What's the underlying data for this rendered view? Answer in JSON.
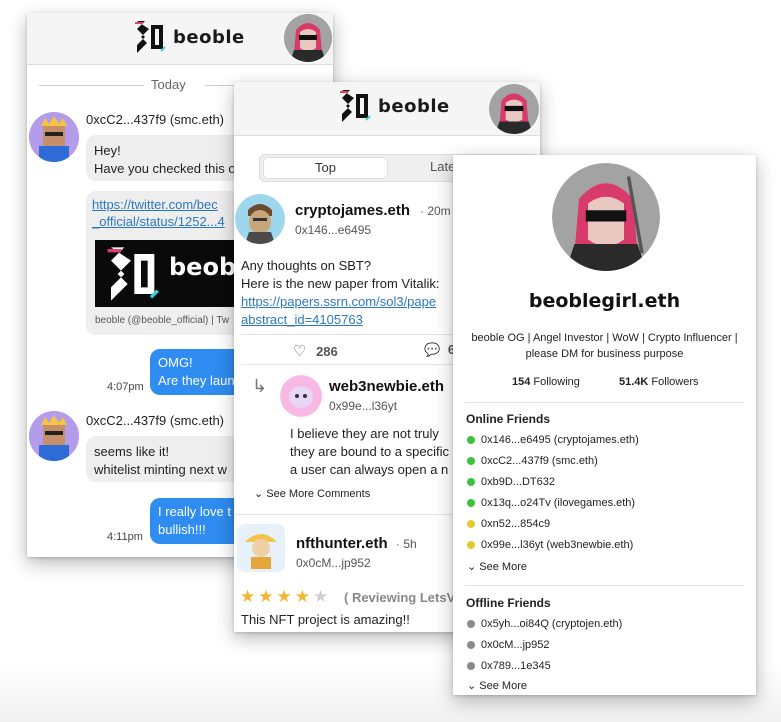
{
  "brand": {
    "name": "beoble"
  },
  "chat": {
    "date_label": "Today",
    "messages": [
      {
        "sender": "0xcC2...437f9 (smc.eth)",
        "text_1": "Hey!",
        "text_2": "Have you checked this o"
      },
      {
        "link_1": "https://twitter.com/bec",
        "link_2": "_official/status/1252...4",
        "preview_caption": "beoble (@beoble_official) | Tw"
      },
      {
        "out_1": "OMG!",
        "out_2": "Are they laun",
        "time": "4:07pm"
      },
      {
        "sender": "0xcC2...437f9 (smc.eth)",
        "text_1": "seems like it!",
        "text_2": "whitelist minting next w"
      },
      {
        "out_1": "I really love t",
        "out_2": "bullish!!!",
        "time": "4:11pm"
      }
    ]
  },
  "feed": {
    "tabs": [
      "Top",
      "Late"
    ],
    "post": {
      "author": "cryptojames.eth",
      "age": "· 20m",
      "address": "0x146...e6495",
      "line_1": "Any thoughts on SBT?",
      "line_2": "Here is the new paper from Vitalik:",
      "link_1": "https://papers.ssrn.com/sol3/pape",
      "link_2": "abstract_id=4105763",
      "likes": "286",
      "comments": "6"
    },
    "reply": {
      "author": "web3newbie.eth",
      "address": "0x99e...l36yt",
      "line_1": "I believe they are not truly",
      "line_2": "they are bound to a specific",
      "line_3": "a user can always open a n"
    },
    "see_more_comments": "See More Comments",
    "review": {
      "author": "nfthunter.eth",
      "age": "· 5h",
      "address": "0x0cM...jp952",
      "stars_filled": 4,
      "stars_total": 5,
      "reviewing": "( Reviewing LetsV",
      "text": "This NFT project is amazing!!"
    }
  },
  "profile": {
    "name": "beoblegirl.eth",
    "bio_1": "beoble OG | Angel Investor | WoW | Crypto Influencer |",
    "bio_2": "please DM for business purpose",
    "following_count": "154",
    "following_label": "Following",
    "followers_count": "51.4K",
    "followers_label": "Followers",
    "online_title": "Online Friends",
    "online": [
      {
        "name": "0x146...e6495 (cryptojames.eth)",
        "color": "#3cc23c"
      },
      {
        "name": "0xcC2...437f9 (smc.eth)",
        "color": "#3cc23c"
      },
      {
        "name": "0xb9D...DT632",
        "color": "#3cc23c"
      },
      {
        "name": "0x13q...o24Tv (ilovegames.eth)",
        "color": "#3cc23c"
      },
      {
        "name": "0xn52...854c9",
        "color": "#e5c92e"
      },
      {
        "name": "0x99e...l36yt (web3newbie.eth)",
        "color": "#e5c92e"
      }
    ],
    "see_more_1": "See More",
    "offline_title": "Offline Friends",
    "offline": [
      {
        "name": "0x5yh...oi84Q (cryptojen.eth)",
        "color": "#8a8a8a"
      },
      {
        "name": "0x0cM...jp952",
        "color": "#8a8a8a"
      },
      {
        "name": "0x789...1e345",
        "color": "#8a8a8a"
      }
    ],
    "see_more_2": "See More"
  }
}
